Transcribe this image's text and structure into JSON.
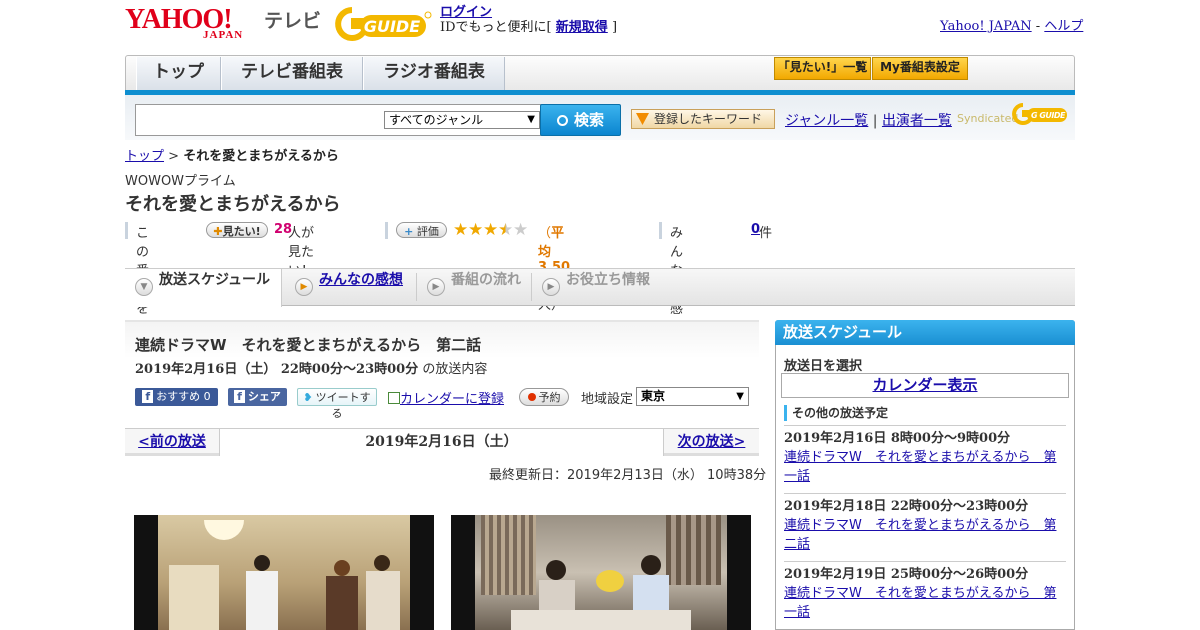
{
  "header": {
    "logo_main": "YAHOO!",
    "logo_sub": "JAPAN",
    "tv_label": "テレビ",
    "guide_logo": "G-GUIDE",
    "login_link": "ログイン",
    "login_note_pre": "IDでもっと便利に[",
    "signup_link": "新規取得",
    "login_note_post": "]",
    "yahoo_japan_link": "Yahoo! JAPAN",
    "link_sep": "-",
    "help_link": "ヘルプ"
  },
  "nav": {
    "tabs": [
      {
        "label": "トップ"
      },
      {
        "label": "テレビ番組表"
      },
      {
        "label": "ラジオ番組表"
      }
    ],
    "want_list_btn": "「見たい!」一覧",
    "my_schedule_btn": "My番組表設定"
  },
  "search": {
    "input_value": "",
    "genre_selected": "すべてのジャンル",
    "search_btn": "検索",
    "keyword_btn": "登録したキーワード",
    "genre_link": "ジャンル一覧",
    "link_sep": "|",
    "performer_link": "出演者一覧",
    "syndicated_text": "Syndicated",
    "syndicated_logo": "G GUIDE"
  },
  "breadcrumb": {
    "home": "トップ",
    "sep": ">",
    "current": "それを愛とまちがえるから"
  },
  "program": {
    "channel": "WOWOWプライム",
    "title": "それを愛とまちがえるから",
    "want_prefix": "この番組を",
    "want_pill": "見たい!",
    "want_count": "28",
    "want_suffix": "人が見たい！",
    "rate_pill": "評価",
    "rating_value": 3.5,
    "rating_max": 5,
    "rating_open": "（",
    "rating_avg_label": "平均",
    "rating_avg": "3.50点",
    "rating_count": "/2人",
    "rating_close": "）",
    "reviews_label": "みんなの感想",
    "reviews_count": "0",
    "reviews_unit": "件"
  },
  "tabs": [
    {
      "label": "放送スケジュール"
    },
    {
      "label": "みんなの感想"
    },
    {
      "label": "番組の流れ"
    },
    {
      "label": "お役立ち情報"
    }
  ],
  "episode": {
    "title": "連続ドラマW　それを愛とまちがえるから　第二話",
    "datetime": "2019年2月16日（土）  22時00分～23時00分",
    "datetime_suffix": "の放送内容",
    "fb_recommend": "おすすめ 0",
    "fb_share": "シェア",
    "tweet": "ツイートする",
    "calendar_link": "カレンダーに登録",
    "reserve_btn": "予約",
    "region_label": "地域設定",
    "region_selected": "東京",
    "prev_link": "<前の放送",
    "pager_date": "2019年2月16日（土）",
    "next_link": "次の放送>",
    "updated": "最終更新日：2019年2月13日（水）  10時38分"
  },
  "sidebar": {
    "title": "放送スケジュール",
    "pick_date": "放送日を選択",
    "calendar_btn": "カレンダー表示",
    "other_label": "その他の放送予定",
    "items": [
      {
        "datetime": "2019年2月16日  8時00分～9時00分",
        "title": "連続ドラマW　それを愛とまちがえるから　第一話"
      },
      {
        "datetime": "2019年2月18日  22時00分～23時00分",
        "title": "連続ドラマW　それを愛とまちがえるから　第二話"
      },
      {
        "datetime": "2019年2月19日  25時00分～26時00分",
        "title": "連続ドラマW　それを愛とまちがえるから　第一話"
      }
    ]
  },
  "colors": {
    "accent_blue": "#0e8ed0",
    "yahoo_red": "#e0001a",
    "star": "#f0a800",
    "rating_orange": "#e07800",
    "want_count": "#d0006f"
  }
}
